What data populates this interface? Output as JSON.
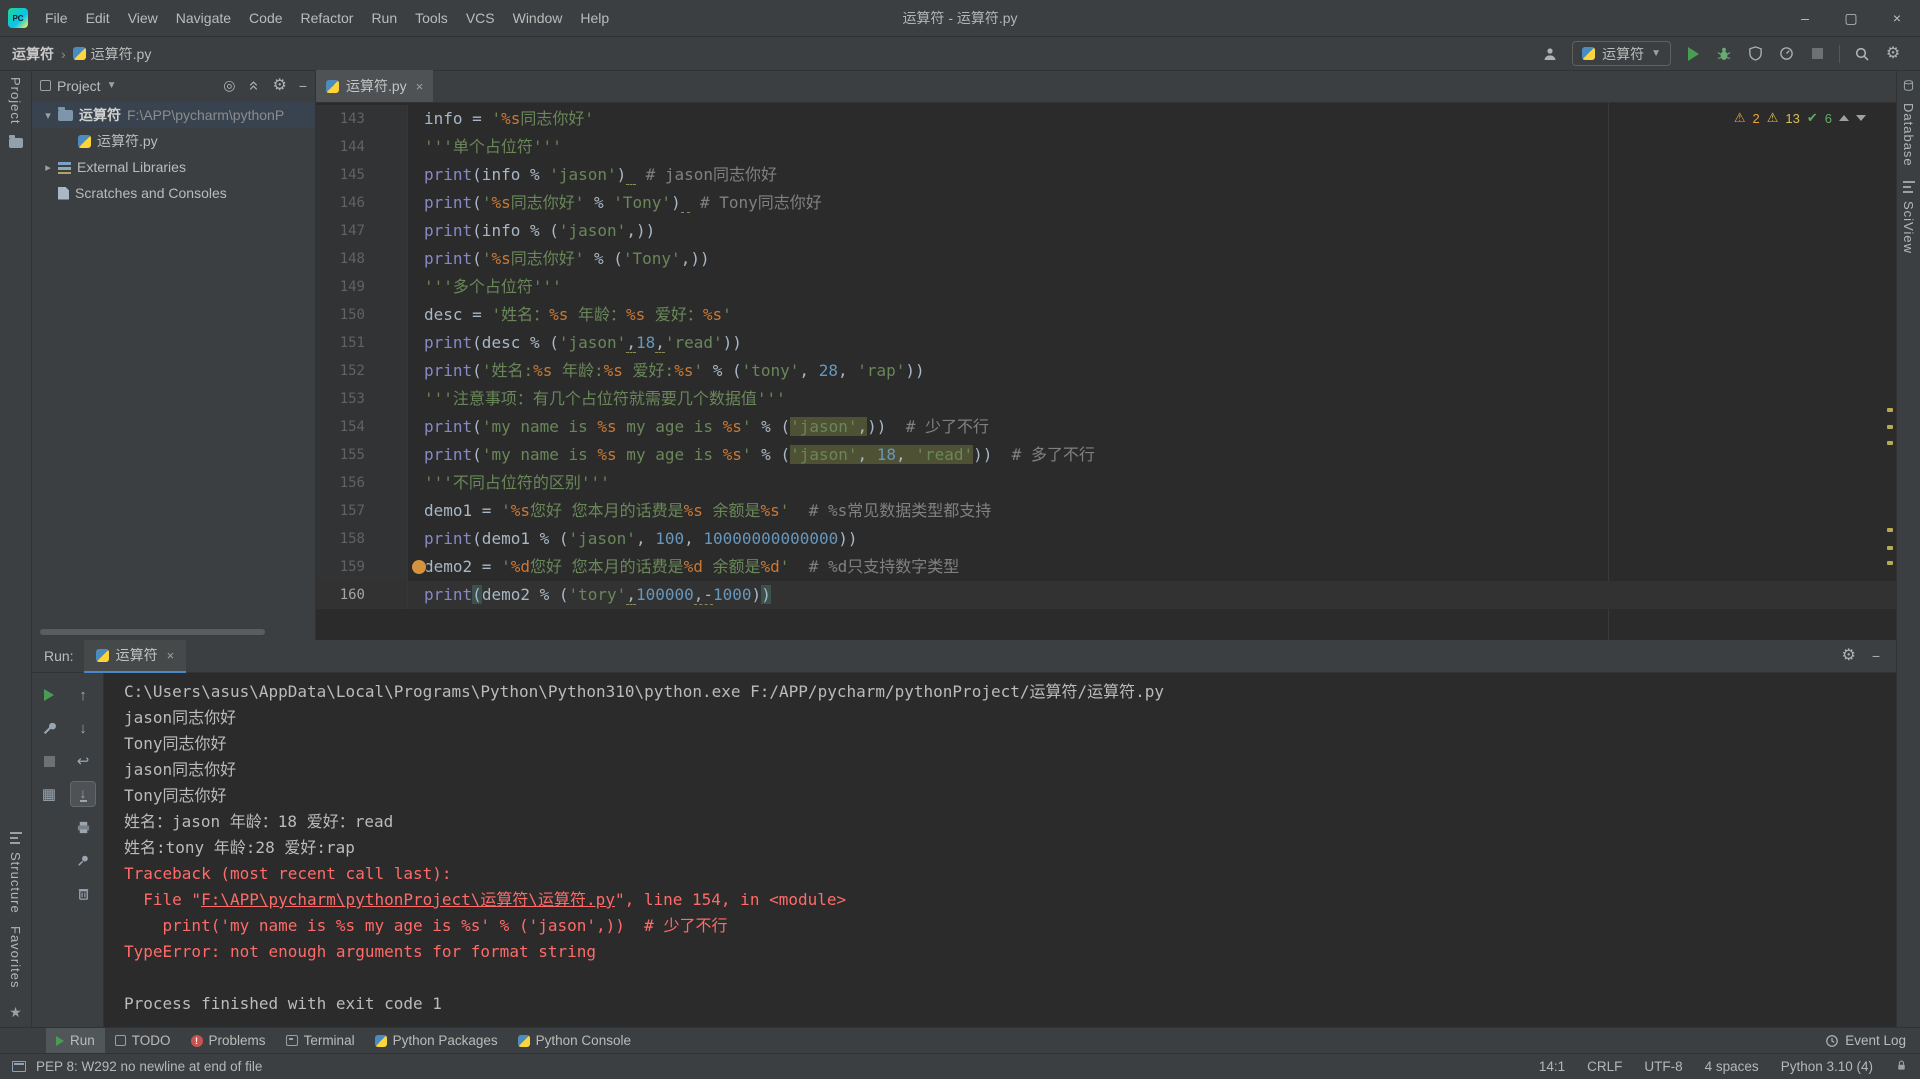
{
  "colors": {
    "accent_green": "#499c54",
    "error_red": "#ff6b68",
    "string_green": "#6a8759",
    "highlight_olive": "#4e5133",
    "run_tab_underline": "#4a88c7"
  },
  "titlebar": {
    "title": "运算符 - 运算符.py",
    "menus": [
      "File",
      "Edit",
      "View",
      "Navigate",
      "Code",
      "Refactor",
      "Run",
      "Tools",
      "VCS",
      "Window",
      "Help"
    ],
    "window_controls": {
      "minimize": "–",
      "maximize": "▢",
      "close": "×"
    }
  },
  "navbar": {
    "breadcrumb_root": "运算符",
    "breadcrumb_sep": "›",
    "breadcrumb_file": "运算符.py",
    "run_config_label": "运算符"
  },
  "stripes": {
    "left_top": "Project",
    "left_bottom": [
      "Structure",
      "Favorites"
    ],
    "right": [
      "Database",
      "SciView"
    ]
  },
  "project_panel": {
    "header_label": "Project",
    "items": [
      {
        "indent": 0,
        "chevron": "down",
        "icon": "project-folder",
        "label": "运算符",
        "hint": "F:\\APP\\pycharm\\pythonP",
        "selected": true,
        "bold": true
      },
      {
        "indent": 1,
        "chevron": "",
        "icon": "python-file",
        "label": "运算符.py"
      },
      {
        "indent": 0,
        "chevron": "right",
        "icon": "libraries",
        "label": "External Libraries"
      },
      {
        "indent": 0,
        "chevron": "",
        "icon": "scratches",
        "label": "Scratches and Consoles"
      }
    ]
  },
  "editor": {
    "tab_label": "运算符.py",
    "tab_close": "×",
    "inspections": {
      "warn_count": "2",
      "weak_count": "13",
      "ok_count": "6"
    },
    "lines": [
      {
        "no": "143",
        "tokens": [
          [
            "p",
            "info = "
          ],
          [
            "s",
            "'"
          ],
          [
            "f",
            "%s"
          ],
          [
            "s",
            "同志你好'"
          ]
        ]
      },
      {
        "no": "144",
        "tokens": [
          [
            "s",
            "'''单个占位符'''"
          ]
        ]
      },
      {
        "no": "145",
        "tokens": [
          [
            "b",
            "print"
          ],
          [
            "p",
            "(info % "
          ],
          [
            "s",
            "'jason'"
          ],
          [
            "p",
            ")"
          ],
          [
            "p u",
            " "
          ],
          [
            "c",
            " # jason同志你好"
          ]
        ]
      },
      {
        "no": "146",
        "tokens": [
          [
            "b",
            "print"
          ],
          [
            "p",
            "("
          ],
          [
            "s",
            "'"
          ],
          [
            "f",
            "%s"
          ],
          [
            "s",
            "同志你好'"
          ],
          [
            "p",
            " % "
          ],
          [
            "s",
            "'Tony'"
          ],
          [
            "p",
            ")"
          ],
          [
            "p u",
            " "
          ],
          [
            "c",
            " # Tony同志你好"
          ]
        ]
      },
      {
        "no": "147",
        "tokens": [
          [
            "b",
            "print"
          ],
          [
            "p",
            "(info % ("
          ],
          [
            "s",
            "'jason'"
          ],
          [
            "p",
            ",))"
          ]
        ]
      },
      {
        "no": "148",
        "tokens": [
          [
            "b",
            "print"
          ],
          [
            "p",
            "("
          ],
          [
            "s",
            "'"
          ],
          [
            "f",
            "%s"
          ],
          [
            "s",
            "同志你好'"
          ],
          [
            "p",
            " % ("
          ],
          [
            "s",
            "'Tony'"
          ],
          [
            "p",
            ",))"
          ]
        ]
      },
      {
        "no": "149",
        "tokens": [
          [
            "s",
            "'''多个占位符'''"
          ]
        ]
      },
      {
        "no": "150",
        "tokens": [
          [
            "p",
            "desc = "
          ],
          [
            "s",
            "'姓名："
          ],
          [
            "f",
            "%s"
          ],
          [
            "s",
            " 年龄："
          ],
          [
            "f",
            "%s"
          ],
          [
            "s",
            " 爱好："
          ],
          [
            "f",
            "%s"
          ],
          [
            "s",
            "'"
          ]
        ]
      },
      {
        "no": "151",
        "tokens": [
          [
            "b",
            "print"
          ],
          [
            "p",
            "(desc % ("
          ],
          [
            "s",
            "'jason'"
          ],
          [
            "p u",
            ","
          ],
          [
            "n",
            "18"
          ],
          [
            "p u",
            ","
          ],
          [
            "s",
            "'read'"
          ],
          [
            "p",
            "))"
          ]
        ]
      },
      {
        "no": "152",
        "tokens": [
          [
            "b",
            "print"
          ],
          [
            "p",
            "("
          ],
          [
            "s",
            "'姓名:"
          ],
          [
            "f",
            "%s"
          ],
          [
            "s",
            " 年龄:"
          ],
          [
            "f",
            "%s"
          ],
          [
            "s",
            " 爱好:"
          ],
          [
            "f",
            "%s"
          ],
          [
            "s",
            "'"
          ],
          [
            "p",
            " % ("
          ],
          [
            "s",
            "'tony'"
          ],
          [
            "p",
            ", "
          ],
          [
            "n",
            "28"
          ],
          [
            "p",
            ", "
          ],
          [
            "s",
            "'rap'"
          ],
          [
            "p",
            "))"
          ]
        ]
      },
      {
        "no": "153",
        "tokens": [
          [
            "s",
            "'''注意事项：有几个占位符就需要几个数据值'''"
          ]
        ]
      },
      {
        "no": "154",
        "tokens": [
          [
            "b",
            "print"
          ],
          [
            "p",
            "("
          ],
          [
            "s",
            "'my name is "
          ],
          [
            "f",
            "%s"
          ],
          [
            "s",
            " my age is "
          ],
          [
            "f",
            "%s"
          ],
          [
            "s",
            "'"
          ],
          [
            "p",
            " % ("
          ],
          [
            "s hl",
            "'jason'"
          ],
          [
            "p hl",
            ","
          ],
          [
            "p",
            "))"
          ],
          [
            "c",
            "  # 少了不行"
          ]
        ]
      },
      {
        "no": "155",
        "tokens": [
          [
            "b",
            "print"
          ],
          [
            "p",
            "("
          ],
          [
            "s",
            "'my name is "
          ],
          [
            "f",
            "%s"
          ],
          [
            "s",
            " my age is "
          ],
          [
            "f",
            "%s"
          ],
          [
            "s",
            "'"
          ],
          [
            "p",
            " % ("
          ],
          [
            "s hl",
            "'jason'"
          ],
          [
            "p hl",
            ", "
          ],
          [
            "n hl",
            "18"
          ],
          [
            "p hl",
            ", "
          ],
          [
            "s hl",
            "'read'"
          ],
          [
            "p",
            "))"
          ],
          [
            "c",
            "  # 多了不行"
          ]
        ]
      },
      {
        "no": "156",
        "tokens": [
          [
            "s",
            "'''不同占位符的区别'''"
          ]
        ]
      },
      {
        "no": "157",
        "tokens": [
          [
            "p",
            "demo1 = "
          ],
          [
            "s",
            "'"
          ],
          [
            "f",
            "%s"
          ],
          [
            "s",
            "您好 您本月的话费是"
          ],
          [
            "f",
            "%s"
          ],
          [
            "s",
            " 余额是"
          ],
          [
            "f",
            "%s"
          ],
          [
            "s",
            "'"
          ],
          [
            "c",
            "  # %s常见数据类型都支持"
          ]
        ]
      },
      {
        "no": "158",
        "tokens": [
          [
            "b",
            "print"
          ],
          [
            "p",
            "(demo1 % ("
          ],
          [
            "s",
            "'jason'"
          ],
          [
            "p",
            ", "
          ],
          [
            "n",
            "100"
          ],
          [
            "p",
            ", "
          ],
          [
            "n",
            "10000000000000"
          ],
          [
            "p",
            "))"
          ]
        ]
      },
      {
        "no": "159",
        "marker": "bulb",
        "tokens": [
          [
            "p",
            "demo2 = "
          ],
          [
            "s",
            "'"
          ],
          [
            "f",
            "%d"
          ],
          [
            "s",
            "您好 您本月的话费是"
          ],
          [
            "f",
            "%d"
          ],
          [
            "s",
            " 余额是"
          ],
          [
            "f",
            "%d"
          ],
          [
            "s",
            "'"
          ],
          [
            "c",
            "  # %d只支持数字类型"
          ]
        ]
      },
      {
        "no": "160",
        "current": true,
        "tokens": [
          [
            "b",
            "print"
          ],
          [
            "p brace",
            "("
          ],
          [
            "p",
            "demo2 % ("
          ],
          [
            "s",
            "'tory'"
          ],
          [
            "p u",
            ","
          ],
          [
            "n",
            "100000"
          ],
          [
            "p u",
            ",-"
          ],
          [
            "n",
            "1000"
          ],
          [
            "p",
            ")"
          ],
          [
            "p brace",
            ")"
          ]
        ]
      }
    ]
  },
  "run_panel": {
    "label": "Run:",
    "tab_label": "运算符",
    "tab_close": "×",
    "console": [
      [
        [
          "con",
          "C:\\Users\\asus\\AppData\\Local\\Programs\\Python\\Python310\\python.exe F:/APP/pycharm/pythonProject/运算符/运算符.py"
        ]
      ],
      [
        [
          "con",
          "jason同志你好"
        ]
      ],
      [
        [
          "con",
          "Tony同志你好"
        ]
      ],
      [
        [
          "con",
          "jason同志你好"
        ]
      ],
      [
        [
          "con",
          "Tony同志你好"
        ]
      ],
      [
        [
          "con",
          "姓名：jason 年龄：18 爱好：read"
        ]
      ],
      [
        [
          "con",
          "姓名:tony 年龄:28 爱好:rap"
        ]
      ],
      [
        [
          "err",
          "Traceback (most recent call last):"
        ]
      ],
      [
        [
          "err",
          "  File \""
        ],
        [
          "link",
          "F:\\APP\\pycharm\\pythonProject\\运算符\\运算符.py"
        ],
        [
          "err",
          "\", line 154, in <module>"
        ]
      ],
      [
        [
          "err",
          "    print('my name is %s my age is %s' % ('jason',))  # 少了不行"
        ]
      ],
      [
        [
          "err",
          "TypeError: not enough arguments for format string"
        ]
      ],
      [
        [
          "con",
          ""
        ]
      ],
      [
        [
          "con",
          "Process finished with exit code 1"
        ]
      ]
    ]
  },
  "toolwindow_bar": {
    "items": [
      {
        "label": "Run",
        "icon": "run-triangle",
        "active": true
      },
      {
        "label": "TODO",
        "icon": "todo"
      },
      {
        "label": "Problems",
        "icon": "problems"
      },
      {
        "label": "Terminal",
        "icon": "terminal"
      },
      {
        "label": "Python Packages",
        "icon": "python"
      },
      {
        "label": "Python Console",
        "icon": "python"
      }
    ],
    "right": "Event Log"
  },
  "status_bar": {
    "message": "PEP 8: W292 no newline at end of file",
    "caret": "14:1",
    "line_sep": "CRLF",
    "encoding": "UTF-8",
    "indent": "4 spaces",
    "interpreter": "Python 3.10 (4)"
  }
}
